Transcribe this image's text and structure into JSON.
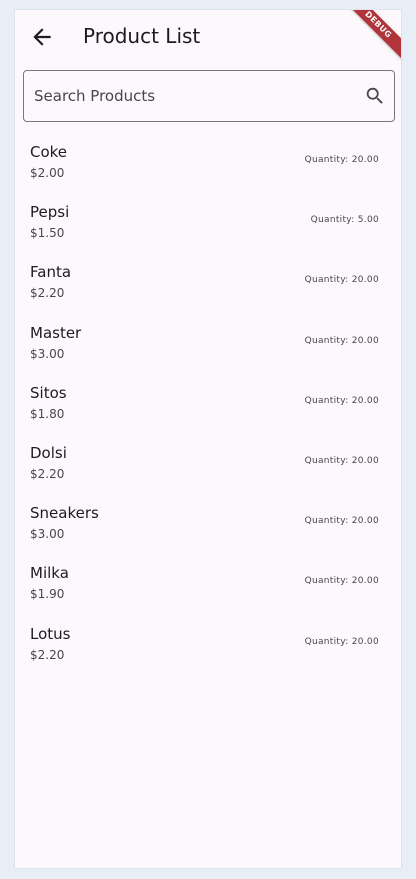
{
  "appbar": {
    "title": "Product List",
    "back_icon": "arrow-left-icon",
    "debug_banner": "DEBUG"
  },
  "search": {
    "placeholder": "Search Products",
    "value": "",
    "icon": "search-icon"
  },
  "products": [
    {
      "name": "Coke",
      "price": "$2.00",
      "quantity": "Quantity: 20.00"
    },
    {
      "name": "Pepsi",
      "price": "$1.50",
      "quantity": "Quantity: 5.00"
    },
    {
      "name": "Fanta",
      "price": "$2.20",
      "quantity": "Quantity: 20.00"
    },
    {
      "name": "Master",
      "price": "$3.00",
      "quantity": "Quantity: 20.00"
    },
    {
      "name": "Sitos",
      "price": "$1.80",
      "quantity": "Quantity: 20.00"
    },
    {
      "name": "Dolsi",
      "price": "$2.20",
      "quantity": "Quantity: 20.00"
    },
    {
      "name": "Sneakers",
      "price": "$3.00",
      "quantity": "Quantity: 20.00"
    },
    {
      "name": "Milka",
      "price": "$1.90",
      "quantity": "Quantity: 20.00"
    },
    {
      "name": "Lotus",
      "price": "$2.20",
      "quantity": "Quantity: 20.00"
    }
  ],
  "colors": {
    "background": "#fdf8fc",
    "outer_background": "#e8eef5",
    "text_primary": "#1d1b20",
    "text_secondary": "#49454f",
    "debug_banner": "#b0343a"
  }
}
